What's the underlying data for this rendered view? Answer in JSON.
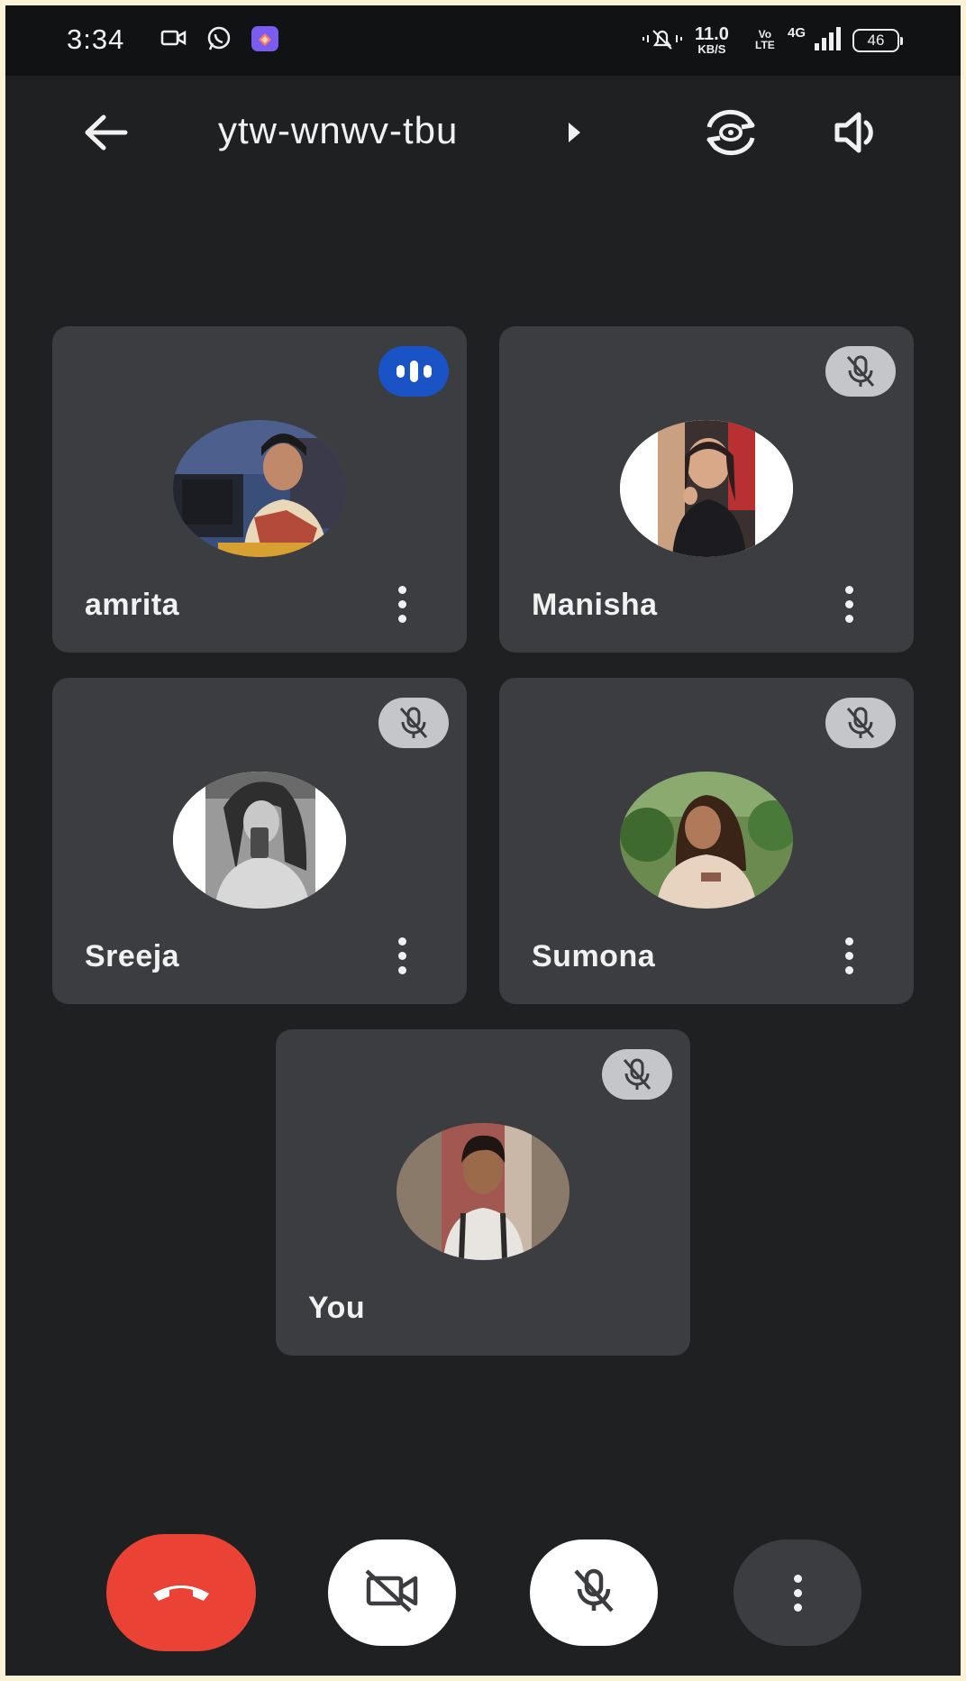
{
  "status_bar": {
    "time": "3:34",
    "net_speed_value": "11.0",
    "net_speed_unit": "KB/S",
    "volte_top": "Vo",
    "volte_bottom": "LTE",
    "network": "4G",
    "battery": "46",
    "icons": [
      "video-camera-icon",
      "whatsapp-icon",
      "app-icon",
      "mute-bell-icon",
      "signal-icon"
    ]
  },
  "top_bar": {
    "meeting_code": "ytw-wnwv-tbu",
    "icons": [
      "back-arrow-icon",
      "caret-right-icon",
      "switch-camera-icon",
      "speaker-icon"
    ]
  },
  "participants": [
    {
      "name": "amrita",
      "audio_state": "speaking"
    },
    {
      "name": "Manisha",
      "audio_state": "muted"
    },
    {
      "name": "Sreeja",
      "audio_state": "muted"
    },
    {
      "name": "Sumona",
      "audio_state": "muted"
    },
    {
      "name": "You",
      "audio_state": "muted"
    }
  ],
  "controls": {
    "icons": [
      "end-call-icon",
      "camera-off-icon",
      "mic-off-icon",
      "more-vert-icon"
    ]
  },
  "colors": {
    "background": "#1f2022",
    "tile": "#3c3d40",
    "end_call": "#ea4335",
    "speaking_badge": "#1a53c6",
    "muted_badge": "#c5c6c9"
  }
}
